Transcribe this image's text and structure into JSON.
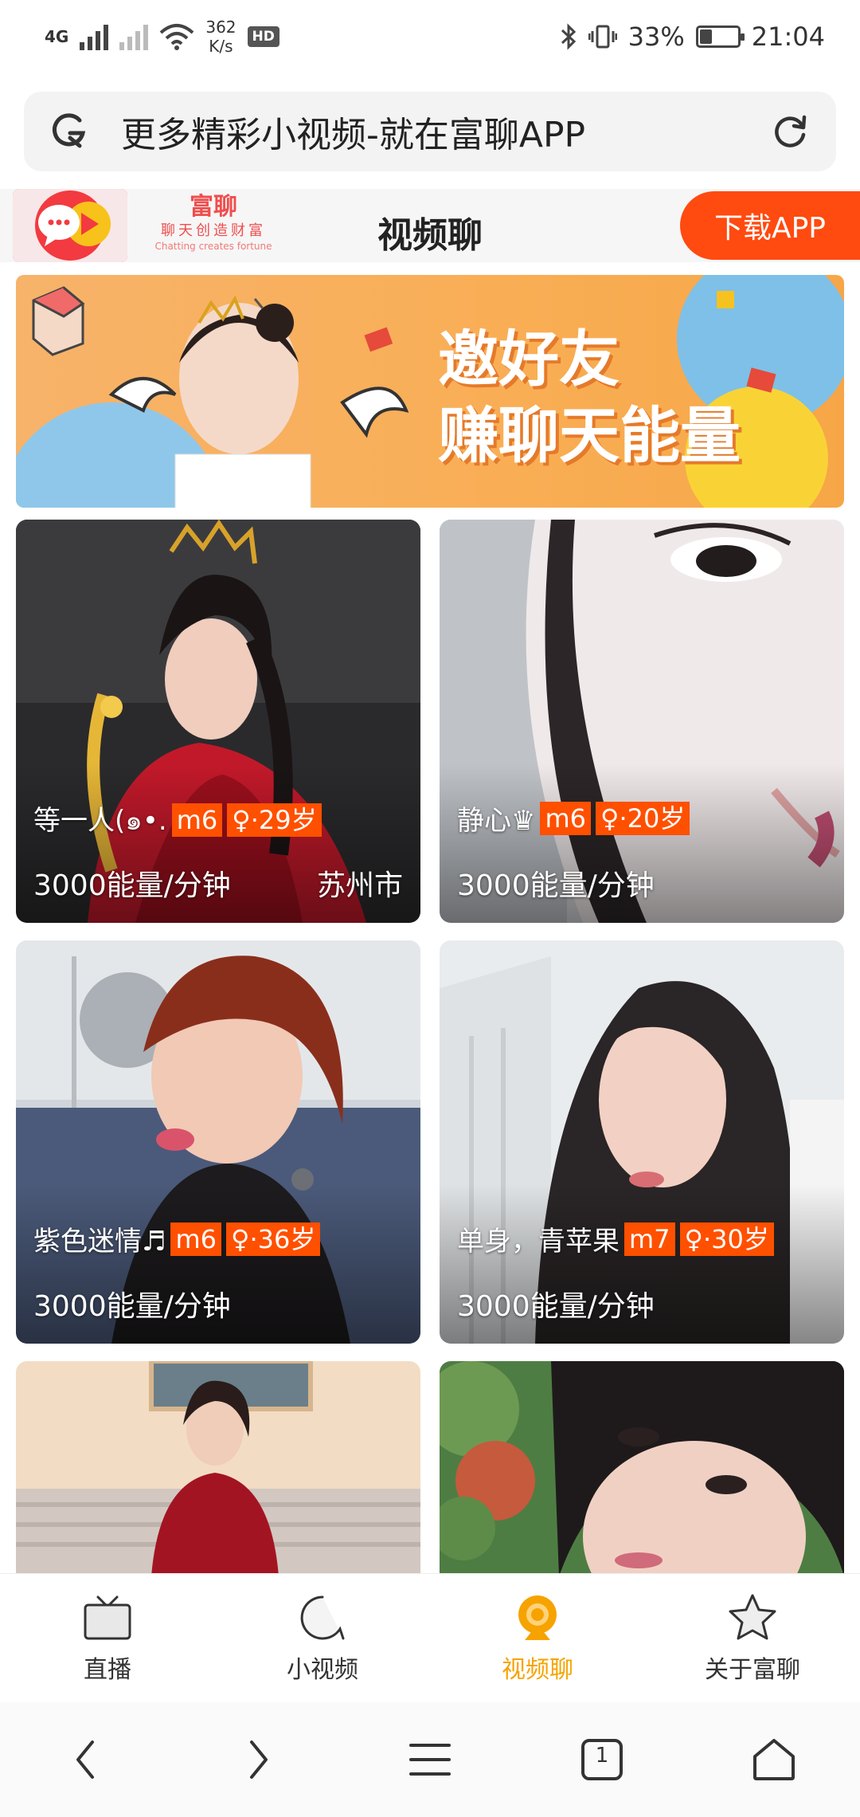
{
  "status_bar": {
    "network": "4G",
    "speed": "362\nK/s",
    "speed_value": "362",
    "speed_unit": "K/s",
    "hd": "HD",
    "battery_percent": "33%",
    "battery_level": 0.33,
    "time": "21:04"
  },
  "address_bar": {
    "title": "更多精彩小视频-就在富聊APP"
  },
  "app_banner": {
    "brand_name": "富聊",
    "brand_slogan": "聊天创造财富",
    "brand_slogan_en": "Chatting creates fortune",
    "title": "视频聊",
    "download_label": "下载APP"
  },
  "promo": {
    "line1": "邀好友",
    "line2": "赚聊天能量"
  },
  "cards": [
    {
      "name": "等一人(๑•.",
      "level": "m6",
      "gender_age": "♀·29岁",
      "price": "3000能量/分钟",
      "city": "苏州市"
    },
    {
      "name": "静心♛",
      "level": "m6",
      "gender_age": "♀·20岁",
      "price": "3000能量/分钟",
      "city": ""
    },
    {
      "name": "紫色迷情♬",
      "level": "m6",
      "gender_age": "♀·36岁",
      "price": "3000能量/分钟",
      "city": ""
    },
    {
      "name": "单身，青苹果",
      "level": "m7",
      "gender_age": "♀·30岁",
      "price": "3000能量/分钟",
      "city": ""
    },
    {
      "name": "",
      "level": "",
      "gender_age": "",
      "price": "",
      "city": ""
    },
    {
      "name": "",
      "level": "",
      "gender_age": "",
      "price": "",
      "city": ""
    }
  ],
  "tabs": [
    {
      "label": "直播",
      "icon": "tv-icon"
    },
    {
      "label": "小视频",
      "icon": "chat-bubble-icon"
    },
    {
      "label": "视频聊",
      "icon": "video-chat-icon",
      "active": true
    },
    {
      "label": "关于富聊",
      "icon": "star-icon"
    }
  ],
  "system_nav": {
    "tab_count": "1"
  },
  "colors": {
    "accent_orange": "#ff4a10",
    "tag_orange": "#ff5000",
    "active_tab": "#f6a300",
    "brand_red": "#f23a40"
  }
}
